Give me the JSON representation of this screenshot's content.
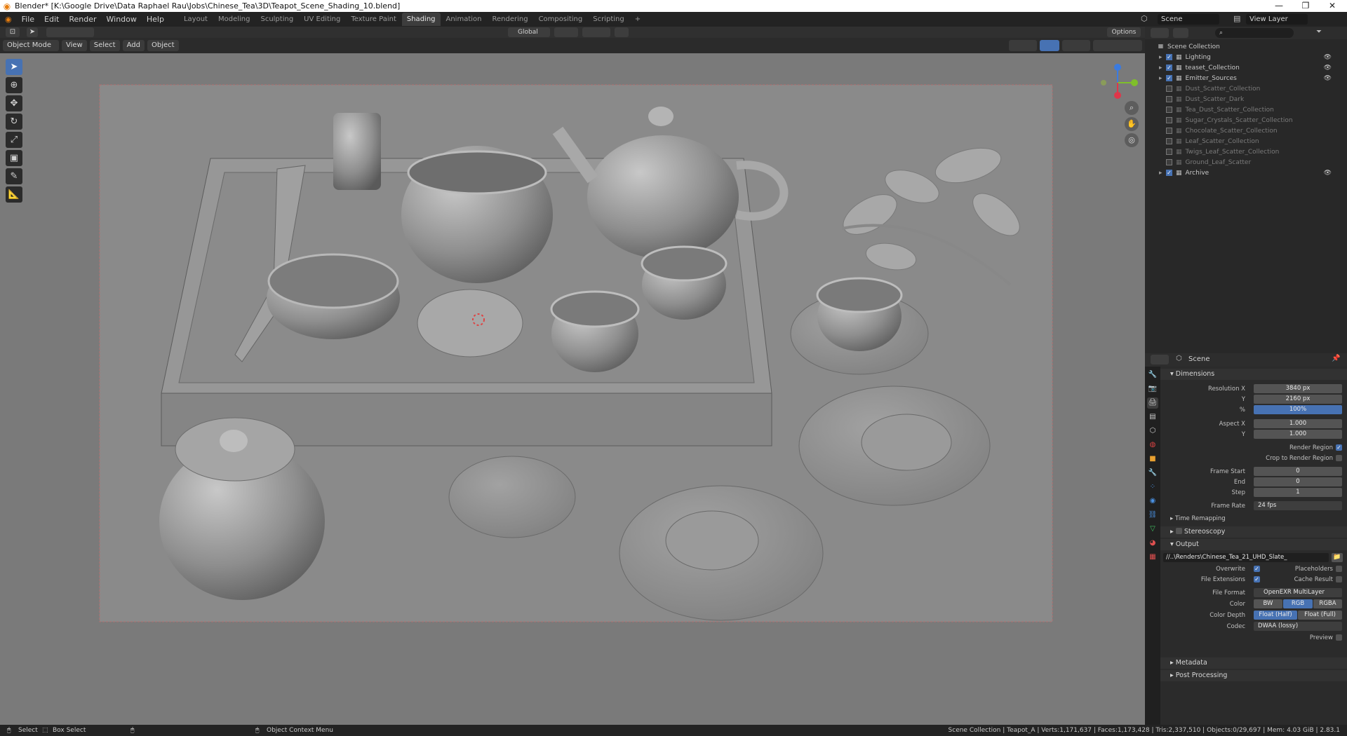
{
  "window": {
    "title": "Blender* [K:\\Google Drive\\Data Raphael Rau\\Jobs\\Chinese_Tea\\3D\\Teapot_Scene_Shading_10.blend]"
  },
  "menu": [
    "File",
    "Edit",
    "Render",
    "Window",
    "Help"
  ],
  "workspaces": [
    "Layout",
    "Modeling",
    "Sculpting",
    "UV Editing",
    "Texture Paint",
    "Shading",
    "Animation",
    "Rendering",
    "Compositing",
    "Scripting"
  ],
  "active_workspace": "Shading",
  "scene_selector": {
    "scene": "Scene",
    "view_layer": "View Layer"
  },
  "viewport_header": {
    "mode": "Object Mode",
    "menus": [
      "View",
      "Select",
      "Add",
      "Object"
    ],
    "orientation": "Global",
    "options": "Options"
  },
  "outliner": {
    "root": "Scene Collection",
    "items": [
      {
        "label": "Lighting",
        "enabled": true
      },
      {
        "label": "teaset_Collection",
        "enabled": true
      },
      {
        "label": "Emitter_Sources",
        "enabled": true
      },
      {
        "label": "Dust_Scatter_Collection",
        "enabled": false
      },
      {
        "label": "Dust_Scatter_Dark",
        "enabled": false
      },
      {
        "label": "Tea_Dust_Scatter_Collection",
        "enabled": false
      },
      {
        "label": "Sugar_Crystals_Scatter_Collection",
        "enabled": false
      },
      {
        "label": "Chocolate_Scatter_Collection",
        "enabled": false
      },
      {
        "label": "Leaf_Scatter_Collection",
        "enabled": false
      },
      {
        "label": "Twigs_Leaf_Scatter_Collection",
        "enabled": false
      },
      {
        "label": "Ground_Leaf_Scatter",
        "enabled": false
      },
      {
        "label": "Archive",
        "enabled": true
      }
    ]
  },
  "properties": {
    "context": "Scene",
    "dimensions": {
      "title": "Dimensions",
      "resolution_x_label": "Resolution X",
      "resolution_x": "3840 px",
      "resolution_y_label": "Y",
      "resolution_y": "2160 px",
      "percent_label": "%",
      "percent": "100%",
      "aspect_x_label": "Aspect X",
      "aspect_x": "1.000",
      "aspect_y_label": "Y",
      "aspect_y": "1.000",
      "render_region": "Render Region",
      "crop_region": "Crop to Render Region",
      "frame_start_label": "Frame Start",
      "frame_start": "0",
      "frame_end_label": "End",
      "frame_end": "0",
      "step_label": "Step",
      "step": "1",
      "frame_rate_label": "Frame Rate",
      "frame_rate": "24 fps",
      "time_remapping": "Time Remapping"
    },
    "stereoscopy": "Stereoscopy",
    "output": {
      "title": "Output",
      "path": "//..\\Renders\\Chinese_Tea_21_UHD_Slate_",
      "overwrite": "Overwrite",
      "placeholders": "Placeholders",
      "file_extensions": "File Extensions",
      "cache_result": "Cache Result",
      "file_format_label": "File Format",
      "file_format": "OpenEXR MultiLayer",
      "color_label": "Color",
      "color_options": [
        "BW",
        "RGB",
        "RGBA"
      ],
      "color_selected": "RGB",
      "depth_label": "Color Depth",
      "depth_options": [
        "Float (Half)",
        "Float (Full)"
      ],
      "depth_selected": "Float (Half)",
      "codec_label": "Codec",
      "codec": "DWAA (lossy)",
      "preview": "Preview"
    },
    "metadata": "Metadata",
    "post_processing": "Post Processing"
  },
  "statusbar": {
    "select": "Select",
    "box_select": "Box Select",
    "context_menu": "Object Context Menu",
    "stats": "Scene Collection | Teapot_A | Verts:1,171,637 | Faces:1,173,428 | Tris:2,337,510 | Objects:0/29,697 | Mem: 4.03 GiB | 2.83.1"
  },
  "colors": {
    "accent": "#4772b3",
    "viewport": "#7a7a7a",
    "panel": "#2b2b2b"
  }
}
